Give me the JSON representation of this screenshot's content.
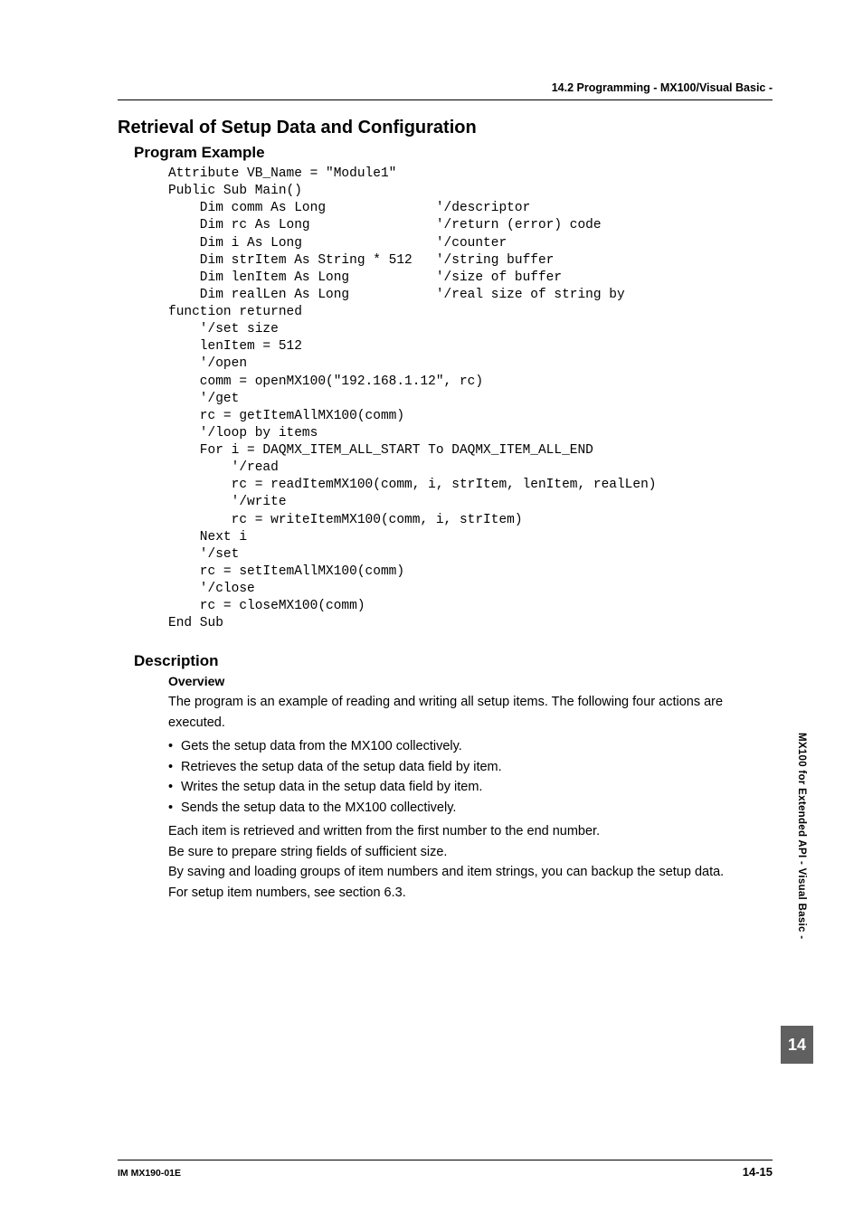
{
  "header": {
    "section_path": "14.2  Programming - MX100/Visual Basic -"
  },
  "h1": "Retrieval of Setup Data and Configuration",
  "program_example": {
    "heading": "Program Example",
    "code": "Attribute VB_Name = \"Module1\"\nPublic Sub Main()\n    Dim comm As Long              '/descriptor\n    Dim rc As Long                '/return (error) code\n    Dim i As Long                 '/counter\n    Dim strItem As String * 512   '/string buffer\n    Dim lenItem As Long           '/size of buffer\n    Dim realLen As Long           '/real size of string by\nfunction returned\n    '/set size\n    lenItem = 512\n    '/open\n    comm = openMX100(\"192.168.1.12\", rc)\n    '/get\n    rc = getItemAllMX100(comm)\n    '/loop by items\n    For i = DAQMX_ITEM_ALL_START To DAQMX_ITEM_ALL_END\n        '/read\n        rc = readItemMX100(comm, i, strItem, lenItem, realLen)\n        '/write\n        rc = writeItemMX100(comm, i, strItem)\n    Next i\n    '/set\n    rc = setItemAllMX100(comm)\n    '/close\n    rc = closeMX100(comm)\nEnd Sub"
  },
  "description": {
    "heading": "Description",
    "overview_heading": "Overview",
    "intro": "The program is an example of reading and writing all setup items. The following four actions are executed.",
    "bullets": [
      "Gets the setup data from the MX100 collectively.",
      "Retrieves the setup data of the setup data field by item.",
      "Writes the setup data in the setup data field by item.",
      "Sends the setup data to the MX100 collectively."
    ],
    "after1": "Each item is retrieved and written from the first number to the end number.",
    "after2": "Be sure to prepare string fields of sufficient size.",
    "after3": "By saving and loading groups of item numbers and item strings, you can backup the setup data.",
    "after4": "For setup item numbers, see section 6.3."
  },
  "sidebar": {
    "tab_label": "MX100 for Extended API - Visual Basic -",
    "chapter_number": "14"
  },
  "footer": {
    "doc_id": "IM MX190-01E",
    "page_number": "14-15"
  }
}
